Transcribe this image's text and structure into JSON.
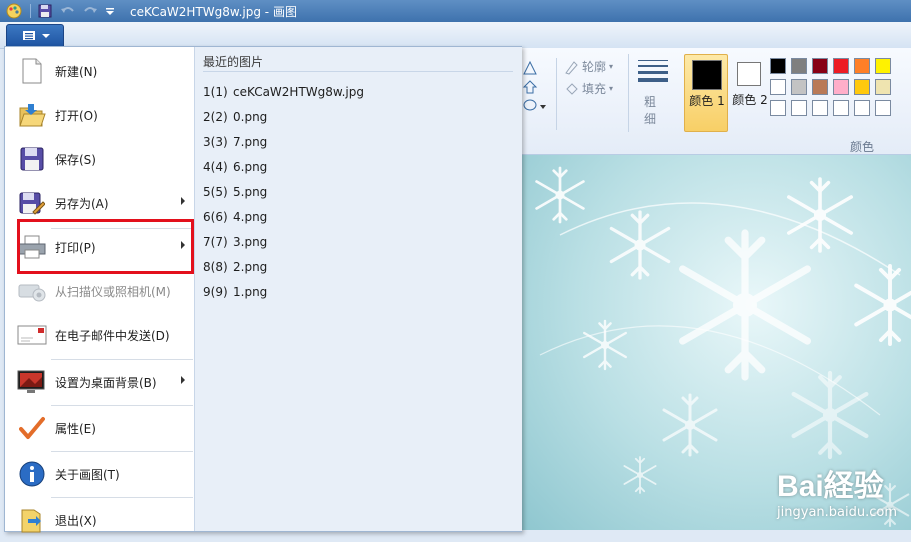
{
  "window": {
    "title": "ceKCaW2HTWg8w.jpg - 画图"
  },
  "menu": {
    "items": [
      {
        "label": "新建(N)",
        "icon": "new-file-icon"
      },
      {
        "label": "打开(O)",
        "icon": "open-folder-icon"
      },
      {
        "label": "保存(S)",
        "icon": "save-disk-icon"
      },
      {
        "label": "另存为(A)",
        "icon": "save-as-icon",
        "has_submenu": true
      },
      {
        "label": "打印(P)",
        "icon": "printer-icon",
        "has_submenu": true
      },
      {
        "label": "从扫描仪或照相机(M)",
        "icon": "scanner-icon",
        "disabled": true
      },
      {
        "label": "在电子邮件中发送(D)",
        "icon": "email-icon"
      },
      {
        "label": "设置为桌面背景(B)",
        "icon": "desktop-icon",
        "has_submenu": true
      },
      {
        "label": "属性(E)",
        "icon": "checkmark-icon"
      },
      {
        "label": "关于画图(T)",
        "icon": "info-icon"
      },
      {
        "label": "退出(X)",
        "icon": "exit-icon"
      }
    ]
  },
  "recent": {
    "title": "最近的图片",
    "files": [
      {
        "num": "1(1)",
        "name": "ceKCaW2HTWg8w.jpg"
      },
      {
        "num": "2(2)",
        "name": "0.png"
      },
      {
        "num": "3(3)",
        "name": "7.png"
      },
      {
        "num": "4(4)",
        "name": "6.png"
      },
      {
        "num": "5(5)",
        "name": "5.png"
      },
      {
        "num": "6(6)",
        "name": "4.png"
      },
      {
        "num": "7(7)",
        "name": "3.png"
      },
      {
        "num": "8(8)",
        "name": "2.png"
      },
      {
        "num": "9(9)",
        "name": "1.png"
      }
    ]
  },
  "ribbon": {
    "outline_label": "轮廓",
    "fill_label": "填充",
    "size_label": "粗细",
    "color1_label": "颜色 1",
    "color2_label": "颜色 2",
    "colors_group_label": "颜色",
    "palette": [
      "#000000",
      "#7f7f7f",
      "#880015",
      "#ed1c24",
      "#ff7f27",
      "#fff200",
      "#ffffff",
      "#c3c3c3",
      "#b97a57",
      "#ffaec9",
      "#ffc90e",
      "#efe4b0",
      "#ffffff",
      "#ffffff",
      "#ffffff",
      "#ffffff",
      "#ffffff",
      "#ffffff"
    ]
  },
  "watermark": {
    "brand": "Bai経验",
    "url": "jingyan.baidu.com"
  }
}
